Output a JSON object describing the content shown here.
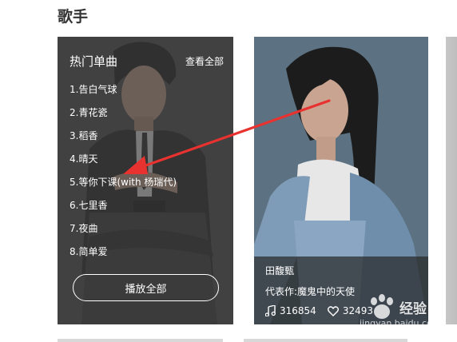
{
  "section": {
    "title": "歌手"
  },
  "hot_card": {
    "title": "热门单曲",
    "view_all": "查看全部",
    "songs": [
      "1.告白气球",
      "2.青花瓷",
      "3.稻香",
      "4.晴天",
      "5.等你下课(with 杨瑞代)",
      "6.七里香",
      "7.夜曲",
      "8.简单爱"
    ],
    "play_all": "播放全部"
  },
  "artist_card": {
    "name": "田馥甄",
    "work_label": "代表作:",
    "work_value": "魔鬼中的天使",
    "plays": "316854",
    "likes": "32493",
    "icons": {
      "plays": "music-note-icon",
      "likes": "heart-icon"
    }
  },
  "annotation": {
    "type": "red-arrow",
    "color": "#e8322f"
  },
  "watermark": {
    "text": "经验",
    "url": "jingyan.baidu.com"
  }
}
